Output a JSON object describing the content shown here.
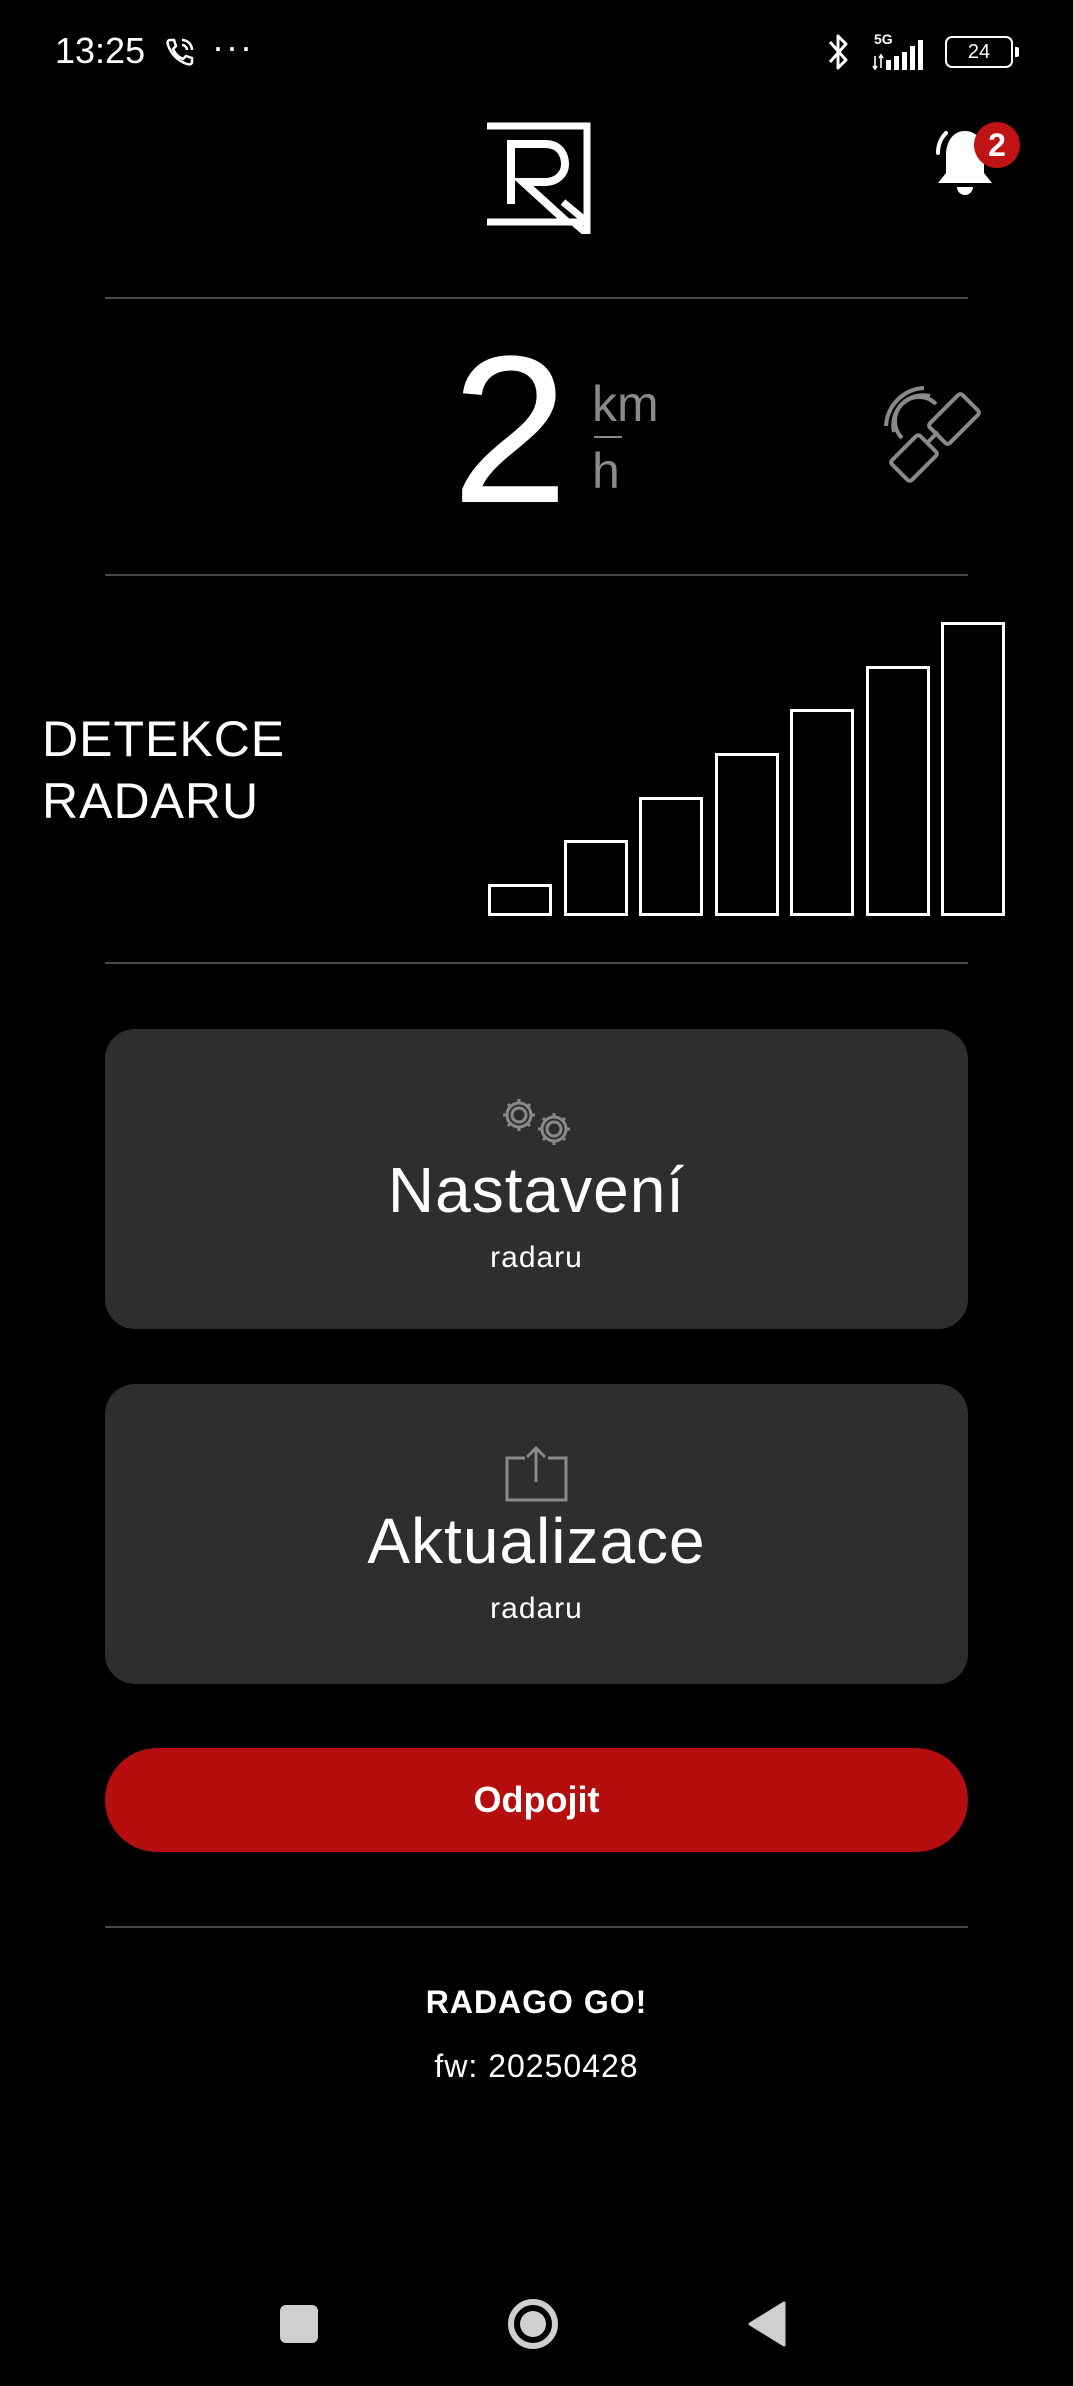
{
  "status_bar": {
    "time": "13:25",
    "dots": "···",
    "network": "5G",
    "battery": "24"
  },
  "header": {
    "notification_count": "2"
  },
  "speed": {
    "value": "2",
    "unit_top": "km",
    "unit_bottom": "h"
  },
  "detection": {
    "label_line1": "DETEKCE",
    "label_line2": "RADARU",
    "bar_levels": [
      1,
      2,
      3,
      4,
      5,
      6,
      7
    ],
    "active_bars": 0
  },
  "cards": [
    {
      "title": "Nastavení",
      "subtitle": "radaru",
      "icon": "gears-icon"
    },
    {
      "title": "Aktualizace",
      "subtitle": "radaru",
      "icon": "upload-icon"
    }
  ],
  "disconnect_label": "Odpojit",
  "device": {
    "name": "RADAGO GO!",
    "firmware": "fw: 20250428"
  },
  "colors": {
    "background": "#000000",
    "card": "#2e2e2e",
    "accent_red": "#b50e0e",
    "divider": "#4a4a4a",
    "muted": "#8a8a8a"
  }
}
